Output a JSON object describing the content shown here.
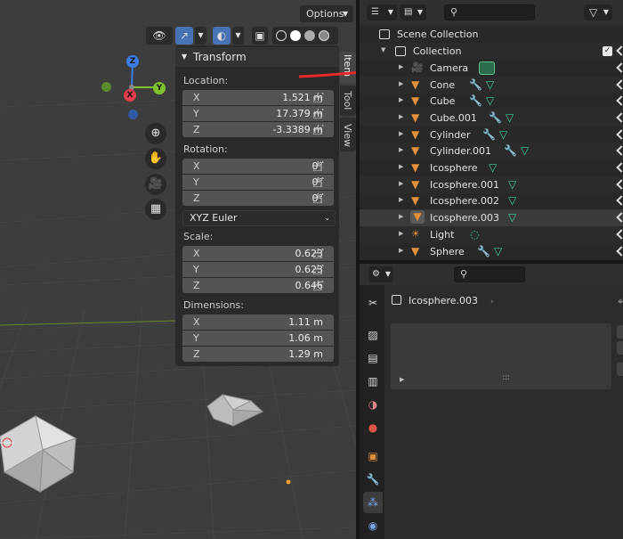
{
  "viewport": {
    "options_label": "Options",
    "gizmo": {
      "x": "X",
      "y": "Y",
      "z": "Z"
    },
    "nav_icons": [
      "zoom-icon",
      "hand-pan-icon",
      "camera-view-icon",
      "grid-perspective-icon"
    ],
    "colors": {
      "x_axis": "#e03d4d",
      "y_axis": "#7fc22c",
      "z_axis": "#3c7ee8",
      "bg": "#3d3d3d"
    }
  },
  "transform_panel": {
    "title": "Transform",
    "location_label": "Location:",
    "location": [
      {
        "axis": "X",
        "value": "1.521 m"
      },
      {
        "axis": "Y",
        "value": "17.379 m"
      },
      {
        "axis": "Z",
        "value": "-3.3389 m"
      }
    ],
    "rotation_label": "Rotation:",
    "rotation": [
      {
        "axis": "X",
        "value": "0°"
      },
      {
        "axis": "Y",
        "value": "0°"
      },
      {
        "axis": "Z",
        "value": "0°"
      }
    ],
    "rotation_mode": "XYZ Euler",
    "scale_label": "Scale:",
    "scale": [
      {
        "axis": "X",
        "value": "0.623"
      },
      {
        "axis": "Y",
        "value": "0.623"
      },
      {
        "axis": "Z",
        "value": "0.646"
      }
    ],
    "dimensions_label": "Dimensions:",
    "dimensions": [
      {
        "axis": "X",
        "value": "1.11 m"
      },
      {
        "axis": "Y",
        "value": "1.06 m"
      },
      {
        "axis": "Z",
        "value": "1.29 m"
      }
    ]
  },
  "side_tabs": [
    "Item",
    "Tool",
    "View"
  ],
  "outliner": {
    "scene_collection": "Scene Collection",
    "collection": "Collection",
    "items": [
      {
        "name": "Camera",
        "type": "camera"
      },
      {
        "name": "Cone",
        "type": "mesh"
      },
      {
        "name": "Cube",
        "type": "mesh"
      },
      {
        "name": "Cube.001",
        "type": "mesh"
      },
      {
        "name": "Cylinder",
        "type": "mesh"
      },
      {
        "name": "Cylinder.001",
        "type": "mesh"
      },
      {
        "name": "Icosphere",
        "type": "mesh"
      },
      {
        "name": "Icosphere.001",
        "type": "mesh"
      },
      {
        "name": "Icosphere.002",
        "type": "mesh"
      },
      {
        "name": "Icosphere.003",
        "type": "mesh"
      },
      {
        "name": "Light",
        "type": "light"
      },
      {
        "name": "Sphere",
        "type": "mesh"
      }
    ]
  },
  "properties": {
    "object_name": "Icosphere.003",
    "tabs": [
      "tool-icon",
      "render-icon",
      "output-icon",
      "view-layer-icon",
      "scene-icon",
      "world-icon",
      "object-icon",
      "modifier-icon",
      "particles-icon",
      "physics-icon"
    ],
    "drag_handle": "::::"
  }
}
